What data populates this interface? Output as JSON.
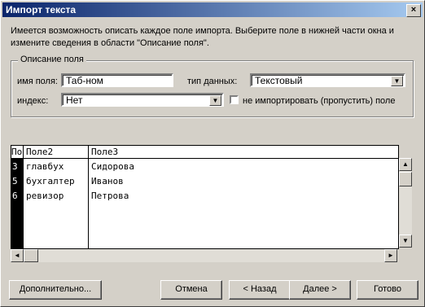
{
  "window": {
    "title": "Импорт текста",
    "close_glyph": "×"
  },
  "description": "Имеется возможность описать каждое поле импорта.  Выберите поле в нижней части окна и измените сведения в области \"Описание поля\".",
  "field_desc": {
    "legend": "Описание поля",
    "name_label": "имя поля:",
    "name_value": "Таб-ном",
    "type_label": "тип данных:",
    "type_value": "Текстовый",
    "index_label": "индекс:",
    "index_value": "Нет",
    "skip_label": "не импортировать (пропустить) поле",
    "skip_checked": false
  },
  "grid": {
    "headers": [
      "По",
      "Поле2",
      "Поле3"
    ],
    "rows": [
      [
        "3",
        "главбух",
        "Сидорова"
      ],
      [
        "5",
        "бухгалтер",
        "Иванов"
      ],
      [
        "6",
        "ревизор",
        "Петрова"
      ]
    ]
  },
  "buttons": {
    "advanced": "Дополнительно...",
    "cancel": "Отмена",
    "back": "< Назад",
    "next": "Далее >",
    "finish": "Готово"
  },
  "icons": {
    "combo_arrow": "▼",
    "scroll_up": "▲",
    "scroll_down": "▼",
    "scroll_left": "◄",
    "scroll_right": "►"
  }
}
